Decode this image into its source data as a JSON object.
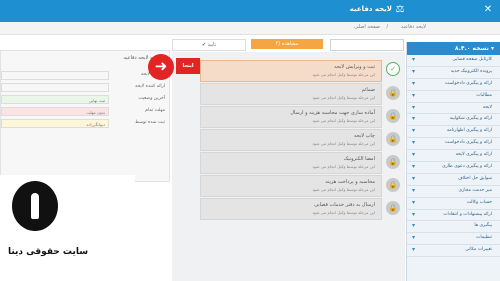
{
  "topbar": {
    "title": "لایحه دفاعیه",
    "close_icon": "close-icon",
    "logo_icon": "scales-icon"
  },
  "breadcrumb": {
    "home": "صفحه اصلی",
    "sep": "/",
    "current": "لایحه دفاعیه"
  },
  "sidebar": {
    "header": "نسخه ۸.۴.۰ ▾",
    "items": [
      "کارتابل صفحه قضایی",
      "پرونده الکترونیک جدید",
      "ارائه و پیگیری دادخواست",
      "مطالبات",
      "لایحه",
      "ارائه و پیگیری شکواییه",
      "ارائه و پیگیری اظهارنامه",
      "ارائه و پیگیری دادخواست",
      "ارائه و پیگیری لایحه",
      "ارائه و پیگیری دعوی طاری",
      "سوابق حل اختلاف",
      "میز خدمت مجازی",
      "حساب وکالت",
      "ارائه پیشنهادات و انتقادات",
      "پیگیری ها",
      "تنظیمات",
      "تغییرات مکانی"
    ]
  },
  "tabs": {
    "orange": "۴) مشاهده",
    "white": "✔ تایید"
  },
  "left_panel": {
    "title": "خلاصه لایحه دفاعیه",
    "rows": [
      {
        "label": "موضوع لایحه",
        "value": ""
      },
      {
        "label": "ارائه کننده لایحه",
        "value": ""
      },
      {
        "label": "آخرین وضعیت",
        "value": "ثبت نهایی"
      },
      {
        "label": "مهلت تمام",
        "value": "بدون مهلت"
      },
      {
        "label": "ثبت شده توسط",
        "value": "دیوانگرزاده"
      }
    ]
  },
  "steps": [
    {
      "t1": "ثبت و ویرایش لایحه",
      "t2": "این مرحله توسط وکیل انجام می شود",
      "icon": "check-icon"
    },
    {
      "t1": "ضمائم",
      "t2": "این مرحله توسط وکیل انجام می شود",
      "icon": "lock-icon"
    },
    {
      "t1": "آماده سازی جهت محاسبه هزینه و ارسال",
      "t2": "این مرحله توسط وکیل انجام می شود",
      "icon": "lock-icon"
    },
    {
      "t1": "چاپ لایحه",
      "t2": "این مرحله توسط وکیل انجام می شود",
      "icon": "lock-icon"
    },
    {
      "t1": "امضا الکترونیک",
      "t2": "این مرحله توسط وکیل انجام می شود",
      "icon": "lock-icon"
    },
    {
      "t1": "محاسبه و پرداخت هزینه",
      "t2": "این مرحله توسط وکیل انجام می شود",
      "icon": "lock-icon"
    },
    {
      "t1": "ارسال به دفتر خدمات قضایی",
      "t2": "این مرحله توسط وکیل انجام می شود",
      "icon": "lock-icon"
    }
  ],
  "red_button": "اینجا",
  "watermark": {
    "caption": "سایت حقوقی دینا",
    "emblem_icon": "quill-emblem"
  }
}
